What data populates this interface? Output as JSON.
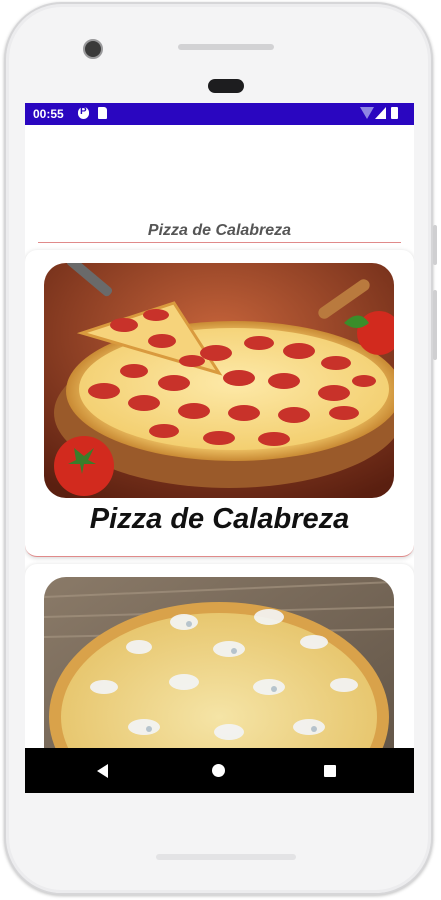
{
  "status_bar": {
    "time": "00:55",
    "icons": [
      "p-badge-icon",
      "sd-card-icon",
      "wifi-icon",
      "signal-icon",
      "battery-icon"
    ]
  },
  "page": {
    "title": "Pizza de Calabreza"
  },
  "cards": [
    {
      "title": "Pizza de Calabreza",
      "image": "pepperoni-pizza-image"
    },
    {
      "title": "",
      "image": "cheese-pizza-image"
    }
  ],
  "nav_bar": {
    "icons": [
      "back-icon",
      "home-icon",
      "recents-icon"
    ]
  },
  "colors": {
    "status_bar": "#2a06c0",
    "divider": "#e08a8a"
  }
}
